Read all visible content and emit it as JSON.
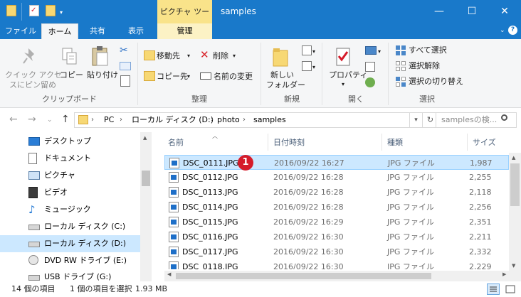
{
  "window": {
    "context_tab_header": "ピクチャ ツール",
    "title": "samples",
    "minimize_glyph": "—",
    "maximize_glyph": "☐",
    "close_glyph": "✕"
  },
  "tabs": [
    "ファイル",
    "ホーム",
    "共有",
    "表示",
    "管理"
  ],
  "ribbon": {
    "clipboard": {
      "pin_label_line1": "クイック アクセ",
      "pin_label_line2": "スにピン留め",
      "copy": "コピー",
      "paste": "貼り付け",
      "group": "クリップボード"
    },
    "organize": {
      "move_to": "移動先",
      "copy_to": "コピー先",
      "delete": "削除",
      "rename": "名前の変更",
      "group": "整理"
    },
    "new": {
      "new_folder_line1": "新しい",
      "new_folder_line2": "フォルダー",
      "group": "新規"
    },
    "open": {
      "properties": "プロパティ",
      "group": "開く"
    },
    "select": {
      "select_all": "すべて選択",
      "select_none": "選択解除",
      "invert_selection": "選択の切り替え",
      "group": "選択"
    }
  },
  "address": {
    "breadcrumb": [
      "PC",
      "ローカル ディスク (D:)",
      "photo",
      "samples"
    ],
    "search_placeholder": "samplesの検..."
  },
  "nav_pane": [
    {
      "label": "デスクトップ",
      "icon": "desktop-icon"
    },
    {
      "label": "ドキュメント",
      "icon": "documents-icon"
    },
    {
      "label": "ピクチャ",
      "icon": "pictures-icon"
    },
    {
      "label": "ビデオ",
      "icon": "videos-icon"
    },
    {
      "label": "ミュージック",
      "icon": "music-icon"
    },
    {
      "label": "ローカル ディスク (C:)",
      "icon": "drive-icon"
    },
    {
      "label": "ローカル ディスク (D:)",
      "icon": "drive-icon",
      "selected": true
    },
    {
      "label": "DVD RW ドライブ (E:)",
      "icon": "dvd-icon"
    },
    {
      "label": "USB ドライブ (G:)",
      "icon": "usb-icon"
    }
  ],
  "columns": [
    "名前",
    "日付時刻",
    "種類",
    "サイズ"
  ],
  "files": [
    {
      "name": "DSC_0111.JPG",
      "date": "2016/09/22 16:27",
      "type": "JPG ファイル",
      "size": "1,987",
      "selected": true
    },
    {
      "name": "DSC_0112.JPG",
      "date": "2016/09/22 16:28",
      "type": "JPG ファイル",
      "size": "2,255"
    },
    {
      "name": "DSC_0113.JPG",
      "date": "2016/09/22 16:28",
      "type": "JPG ファイル",
      "size": "2,118"
    },
    {
      "name": "DSC_0114.JPG",
      "date": "2016/09/22 16:28",
      "type": "JPG ファイル",
      "size": "2,256"
    },
    {
      "name": "DSC_0115.JPG",
      "date": "2016/09/22 16:29",
      "type": "JPG ファイル",
      "size": "2,351"
    },
    {
      "name": "DSC_0116.JPG",
      "date": "2016/09/22 16:30",
      "type": "JPG ファイル",
      "size": "2,211"
    },
    {
      "name": "DSC_0117.JPG",
      "date": "2016/09/22 16:30",
      "type": "JPG ファイル",
      "size": "2,332"
    },
    {
      "name": "DSC_0118.JPG",
      "date": "2016/09/22 16:30",
      "type": "JPG ファイル",
      "size": "2,229"
    }
  ],
  "badge": "1",
  "status": {
    "item_count": "14 個の項目",
    "selected": "1 個の項目を選択",
    "size": "1.93 MB"
  },
  "colors": {
    "titlebar": "#1979ca",
    "context_tab": "#f9e38a",
    "selection": "#cce8ff",
    "badge": "#d51b2a"
  }
}
